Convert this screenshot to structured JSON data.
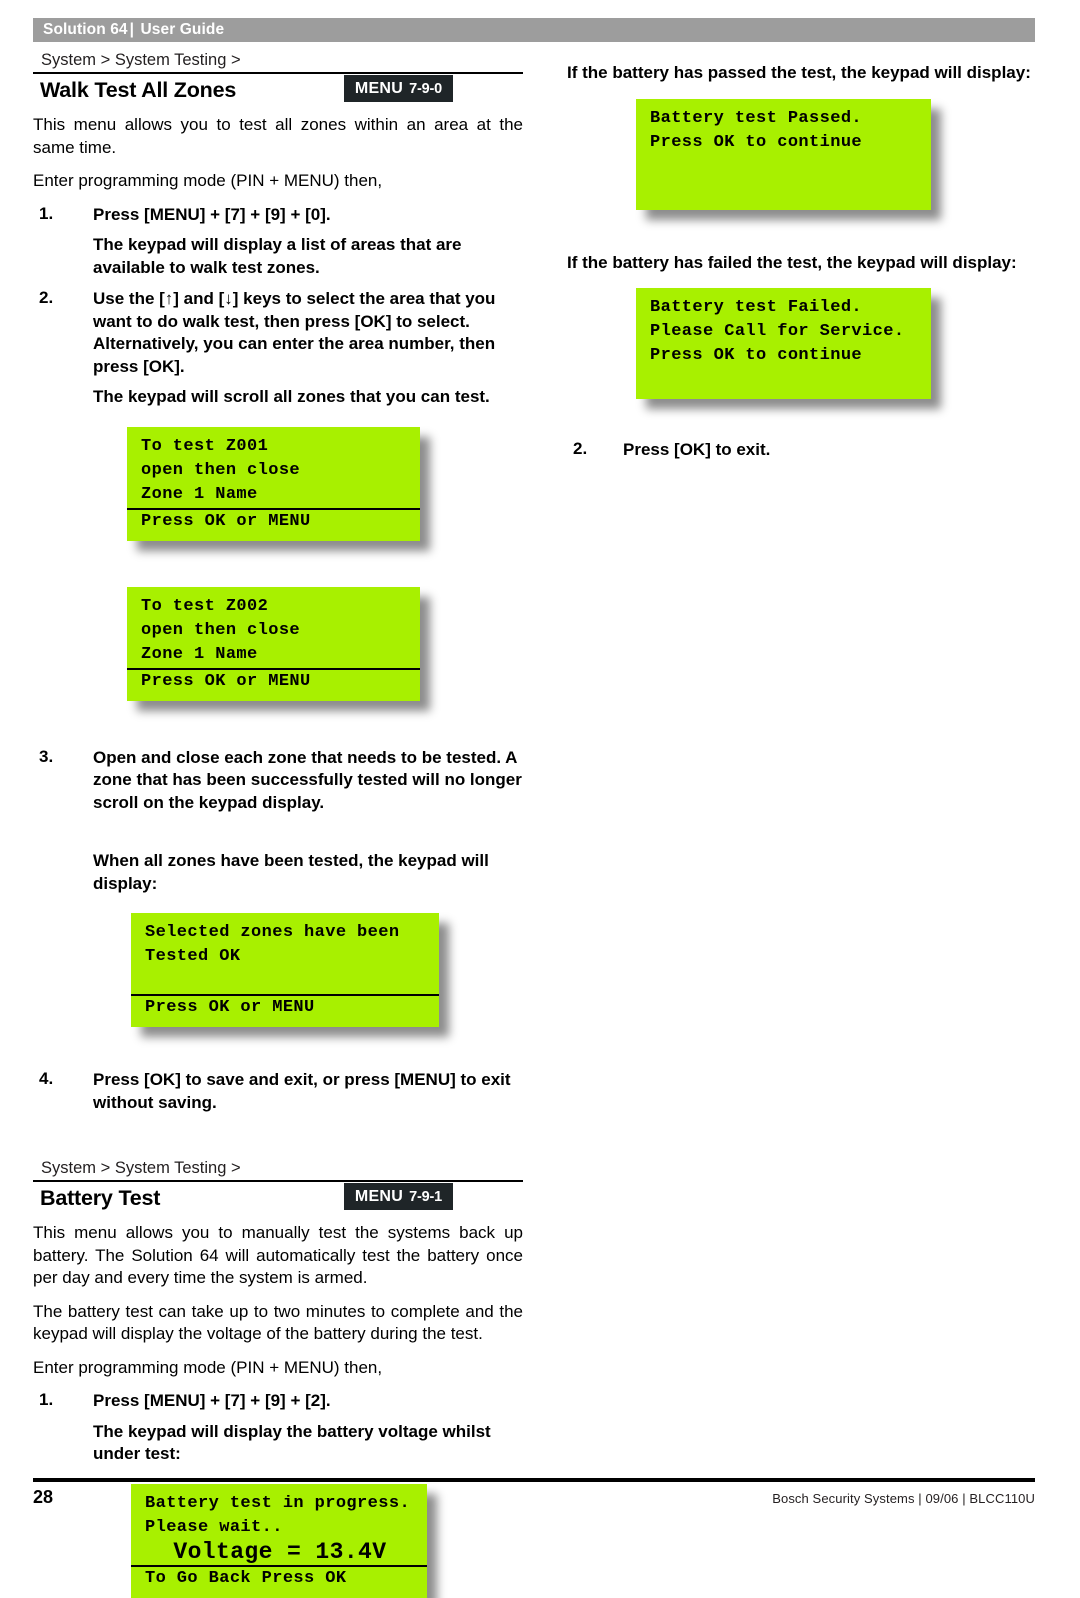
{
  "running_head": {
    "product": "Solution 64",
    "separator": "|",
    "doc_type": "User Guide"
  },
  "sections": [
    {
      "breadcrumb": "System > System Testing >",
      "title": "Walk Test All Zones",
      "menu_label": "MENU",
      "menu_code": "7-9-0",
      "intro": "This menu allows you to test all zones within an area at the same time.",
      "enter_line": "Enter programming mode (PIN + MENU) then,",
      "step1_num": "1.",
      "step1_text": "Press [MENU] + [7] + [9] + [0].",
      "step1_sub": "The keypad will display a list of areas that are available to walk test zones.",
      "step2_num": "2.",
      "step2_text": "Use the [↑] and [↓] keys to select the area that you want to do walk test, then press [OK] to select.  Alternatively, you can enter the area number, then press [OK].",
      "step2_sub": "The keypad will scroll all zones that you can test.",
      "step3_num": "3.",
      "step3_text": "Open and close each zone that needs to be tested.  A zone that has been successfully tested will no longer scroll on the keypad display.",
      "step3_note": "When all zones have been tested, the keypad will display:",
      "step4_num": "4.",
      "step4_text": "Press [OK] to save and exit, or press [MENU] to exit without saving."
    },
    {
      "breadcrumb": "System > System Testing >",
      "title": "Battery Test",
      "menu_label": "MENU",
      "menu_code": "7-9-1",
      "para1": "This menu allows you to manually test the systems back up battery.  The Solution 64 will automatically test the battery once per day and every time the system is armed.",
      "para2": "The battery test can take up to two minutes to complete and the keypad will display the voltage of the battery during the test.",
      "enter_line": "Enter programming mode (PIN + MENU) then,",
      "step1_num": "1.",
      "step1_text": "Press [MENU] + [7] + [9] + [2].",
      "step1_sub": "The keypad will display the battery voltage whilst under test:"
    }
  ],
  "right_column": {
    "passed_caption": "If the battery has passed the test, the keypad will display:",
    "failed_caption": "If the battery has failed the test, the keypad will display:",
    "step2_num": "2.",
    "step2_text": "Press [OK] to exit."
  },
  "displays": {
    "walk_test_z001": {
      "line1": "To test Z001",
      "line2": "open then close",
      "line3": "Zone 1 Name",
      "line4": "Press OK or MENU"
    },
    "walk_test_z002": {
      "line1": "To test Z002",
      "line2": "open then close",
      "line3": "Zone 1 Name",
      "line4": "Press OK or MENU"
    },
    "zones_tested_ok": {
      "line1": "Selected zones have been",
      "line2": "Tested OK",
      "line3": "",
      "line4": "Press OK or MENU"
    },
    "battery_in_progress": {
      "line1": "Battery test in progress.",
      "line2": "Please wait..",
      "line3": "  Voltage = 13.4V",
      "line4": "To Go Back Press OK"
    },
    "battery_passed": {
      "line1": "Battery test Passed.",
      "line2": "Press OK to continue",
      "line3": "",
      "line4": ""
    },
    "battery_failed": {
      "line1": "Battery test Failed.",
      "line2": "Please Call for Service.",
      "line3": "Press OK to continue",
      "line4": ""
    }
  },
  "footer": {
    "page_number": "28",
    "imprint": "Bosch Security Systems | 09/06 | BLCC110U"
  },
  "colors": {
    "lcd_green": "#a8f000",
    "running_head_gray": "#9d9d9d",
    "menu_badge_dark": "#1f2528"
  }
}
